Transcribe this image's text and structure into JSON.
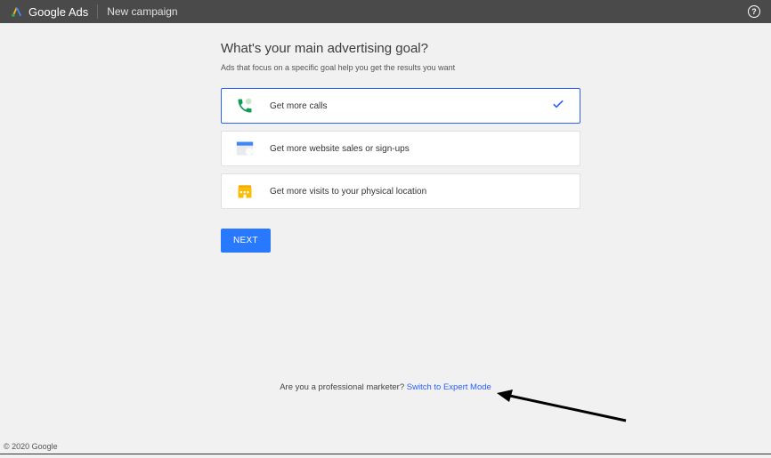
{
  "header": {
    "product": "Google Ads",
    "page": "New campaign"
  },
  "main": {
    "heading": "What's your main advertising goal?",
    "subheading": "Ads that focus on a specific goal help you get the results you want",
    "options": [
      {
        "label": "Get more calls",
        "selected": true
      },
      {
        "label": "Get more website sales or sign-ups",
        "selected": false
      },
      {
        "label": "Get more visits to your physical location",
        "selected": false
      }
    ],
    "next_label": "NEXT"
  },
  "footer": {
    "prompt": "Are you a professional marketer? ",
    "link": "Switch to Expert Mode",
    "copyright": "© 2020 Google"
  }
}
